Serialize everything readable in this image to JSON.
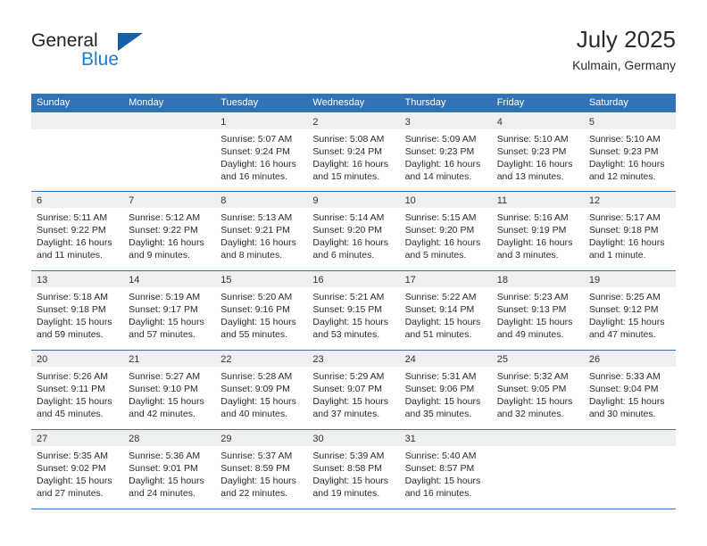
{
  "logo": {
    "word_top": "General",
    "word_bottom": "Blue",
    "triangle_color": "#1560a8",
    "blue_text_color": "#1b7fd4"
  },
  "header": {
    "title": "July 2025",
    "subtitle": "Kulmain, Germany"
  },
  "theme": {
    "accent": "#3073b6",
    "day_band": "#efefef",
    "text": "#2b2b2b"
  },
  "weekdays": [
    "Sunday",
    "Monday",
    "Tuesday",
    "Wednesday",
    "Thursday",
    "Friday",
    "Saturday"
  ],
  "weeks": [
    [
      {
        "day": "",
        "lines": []
      },
      {
        "day": "",
        "lines": []
      },
      {
        "day": "1",
        "lines": [
          "Sunrise: 5:07 AM",
          "Sunset: 9:24 PM",
          "Daylight: 16 hours",
          "and 16 minutes."
        ]
      },
      {
        "day": "2",
        "lines": [
          "Sunrise: 5:08 AM",
          "Sunset: 9:24 PM",
          "Daylight: 16 hours",
          "and 15 minutes."
        ]
      },
      {
        "day": "3",
        "lines": [
          "Sunrise: 5:09 AM",
          "Sunset: 9:23 PM",
          "Daylight: 16 hours",
          "and 14 minutes."
        ]
      },
      {
        "day": "4",
        "lines": [
          "Sunrise: 5:10 AM",
          "Sunset: 9:23 PM",
          "Daylight: 16 hours",
          "and 13 minutes."
        ]
      },
      {
        "day": "5",
        "lines": [
          "Sunrise: 5:10 AM",
          "Sunset: 9:23 PM",
          "Daylight: 16 hours",
          "and 12 minutes."
        ]
      }
    ],
    [
      {
        "day": "6",
        "lines": [
          "Sunrise: 5:11 AM",
          "Sunset: 9:22 PM",
          "Daylight: 16 hours",
          "and 11 minutes."
        ]
      },
      {
        "day": "7",
        "lines": [
          "Sunrise: 5:12 AM",
          "Sunset: 9:22 PM",
          "Daylight: 16 hours",
          "and 9 minutes."
        ]
      },
      {
        "day": "8",
        "lines": [
          "Sunrise: 5:13 AM",
          "Sunset: 9:21 PM",
          "Daylight: 16 hours",
          "and 8 minutes."
        ]
      },
      {
        "day": "9",
        "lines": [
          "Sunrise: 5:14 AM",
          "Sunset: 9:20 PM",
          "Daylight: 16 hours",
          "and 6 minutes."
        ]
      },
      {
        "day": "10",
        "lines": [
          "Sunrise: 5:15 AM",
          "Sunset: 9:20 PM",
          "Daylight: 16 hours",
          "and 5 minutes."
        ]
      },
      {
        "day": "11",
        "lines": [
          "Sunrise: 5:16 AM",
          "Sunset: 9:19 PM",
          "Daylight: 16 hours",
          "and 3 minutes."
        ]
      },
      {
        "day": "12",
        "lines": [
          "Sunrise: 5:17 AM",
          "Sunset: 9:18 PM",
          "Daylight: 16 hours",
          "and 1 minute."
        ]
      }
    ],
    [
      {
        "day": "13",
        "lines": [
          "Sunrise: 5:18 AM",
          "Sunset: 9:18 PM",
          "Daylight: 15 hours",
          "and 59 minutes."
        ]
      },
      {
        "day": "14",
        "lines": [
          "Sunrise: 5:19 AM",
          "Sunset: 9:17 PM",
          "Daylight: 15 hours",
          "and 57 minutes."
        ]
      },
      {
        "day": "15",
        "lines": [
          "Sunrise: 5:20 AM",
          "Sunset: 9:16 PM",
          "Daylight: 15 hours",
          "and 55 minutes."
        ]
      },
      {
        "day": "16",
        "lines": [
          "Sunrise: 5:21 AM",
          "Sunset: 9:15 PM",
          "Daylight: 15 hours",
          "and 53 minutes."
        ]
      },
      {
        "day": "17",
        "lines": [
          "Sunrise: 5:22 AM",
          "Sunset: 9:14 PM",
          "Daylight: 15 hours",
          "and 51 minutes."
        ]
      },
      {
        "day": "18",
        "lines": [
          "Sunrise: 5:23 AM",
          "Sunset: 9:13 PM",
          "Daylight: 15 hours",
          "and 49 minutes."
        ]
      },
      {
        "day": "19",
        "lines": [
          "Sunrise: 5:25 AM",
          "Sunset: 9:12 PM",
          "Daylight: 15 hours",
          "and 47 minutes."
        ]
      }
    ],
    [
      {
        "day": "20",
        "lines": [
          "Sunrise: 5:26 AM",
          "Sunset: 9:11 PM",
          "Daylight: 15 hours",
          "and 45 minutes."
        ]
      },
      {
        "day": "21",
        "lines": [
          "Sunrise: 5:27 AM",
          "Sunset: 9:10 PM",
          "Daylight: 15 hours",
          "and 42 minutes."
        ]
      },
      {
        "day": "22",
        "lines": [
          "Sunrise: 5:28 AM",
          "Sunset: 9:09 PM",
          "Daylight: 15 hours",
          "and 40 minutes."
        ]
      },
      {
        "day": "23",
        "lines": [
          "Sunrise: 5:29 AM",
          "Sunset: 9:07 PM",
          "Daylight: 15 hours",
          "and 37 minutes."
        ]
      },
      {
        "day": "24",
        "lines": [
          "Sunrise: 5:31 AM",
          "Sunset: 9:06 PM",
          "Daylight: 15 hours",
          "and 35 minutes."
        ]
      },
      {
        "day": "25",
        "lines": [
          "Sunrise: 5:32 AM",
          "Sunset: 9:05 PM",
          "Daylight: 15 hours",
          "and 32 minutes."
        ]
      },
      {
        "day": "26",
        "lines": [
          "Sunrise: 5:33 AM",
          "Sunset: 9:04 PM",
          "Daylight: 15 hours",
          "and 30 minutes."
        ]
      }
    ],
    [
      {
        "day": "27",
        "lines": [
          "Sunrise: 5:35 AM",
          "Sunset: 9:02 PM",
          "Daylight: 15 hours",
          "and 27 minutes."
        ]
      },
      {
        "day": "28",
        "lines": [
          "Sunrise: 5:36 AM",
          "Sunset: 9:01 PM",
          "Daylight: 15 hours",
          "and 24 minutes."
        ]
      },
      {
        "day": "29",
        "lines": [
          "Sunrise: 5:37 AM",
          "Sunset: 8:59 PM",
          "Daylight: 15 hours",
          "and 22 minutes."
        ]
      },
      {
        "day": "30",
        "lines": [
          "Sunrise: 5:39 AM",
          "Sunset: 8:58 PM",
          "Daylight: 15 hours",
          "and 19 minutes."
        ]
      },
      {
        "day": "31",
        "lines": [
          "Sunrise: 5:40 AM",
          "Sunset: 8:57 PM",
          "Daylight: 15 hours",
          "and 16 minutes."
        ]
      },
      {
        "day": "",
        "lines": []
      },
      {
        "day": "",
        "lines": []
      }
    ]
  ]
}
